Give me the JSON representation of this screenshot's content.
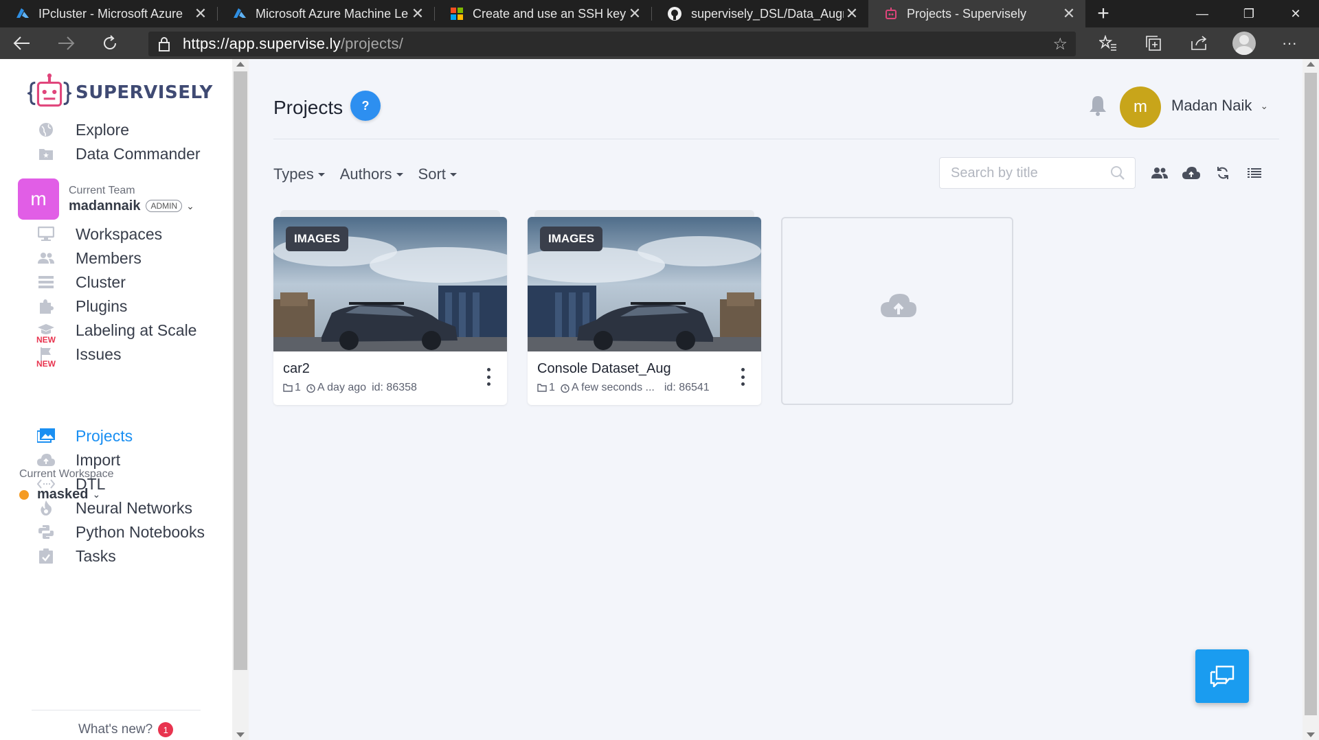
{
  "browser": {
    "tabs": [
      {
        "title": "IPcluster - Microsoft Azure",
        "icon": "azure-icon"
      },
      {
        "title": "Microsoft Azure Machine Le",
        "icon": "azure-icon"
      },
      {
        "title": "Create and use an SSH key",
        "icon": "microsoft-icon"
      },
      {
        "title": "supervisely_DSL/Data_Augn",
        "icon": "github-icon"
      },
      {
        "title": "Projects - Supervisely",
        "icon": "supervisely-icon",
        "active": true
      }
    ],
    "url_host": "https://app.supervise.ly",
    "url_path": "/projects/"
  },
  "sidebar": {
    "logo_text": "SUPERVISELY",
    "top_items": [
      {
        "label": "Explore",
        "icon": "globe-icon"
      },
      {
        "label": "Data Commander",
        "icon": "folder-star-icon"
      }
    ],
    "team": {
      "caption": "Current Team",
      "avatar_letter": "m",
      "name": "madannaik",
      "role": "ADMIN"
    },
    "team_items": [
      {
        "label": "Workspaces",
        "icon": "monitor-icon"
      },
      {
        "label": "Members",
        "icon": "members-icon"
      },
      {
        "label": "Cluster",
        "icon": "cluster-icon"
      },
      {
        "label": "Plugins",
        "icon": "puzzle-icon"
      },
      {
        "label": "Labeling at Scale",
        "icon": "graduation-cap-icon",
        "badge": "NEW"
      },
      {
        "label": "Issues",
        "icon": "flag-icon",
        "badge": "NEW"
      }
    ],
    "workspace": {
      "caption": "Current Workspace",
      "name": "masked",
      "dot_color": "#f59b23"
    },
    "workspace_items": [
      {
        "label": "Projects",
        "icon": "image-gallery-icon",
        "active": true
      },
      {
        "label": "Import",
        "icon": "cloud-upload-icon"
      },
      {
        "label": "DTL",
        "icon": "code-arrows-icon"
      },
      {
        "label": "Neural Networks",
        "icon": "flame-icon"
      },
      {
        "label": "Python Notebooks",
        "icon": "python-icon"
      },
      {
        "label": "Tasks",
        "icon": "clipboard-check-icon"
      }
    ],
    "whats_new": "What's new?",
    "whats_new_count": "1"
  },
  "header": {
    "title": "Projects",
    "help": "?",
    "user_initial": "m",
    "user_name": "Madan Naik"
  },
  "filters": {
    "types": "Types",
    "authors": "Authors",
    "sort": "Sort",
    "search_placeholder": "Search by title"
  },
  "projects": [
    {
      "type": "IMAGES",
      "title": "car2",
      "count": "1",
      "time": "A day ago",
      "id": "id: 86358"
    },
    {
      "type": "IMAGES",
      "title": "Console Dataset_Aug",
      "count": "1",
      "time": "A few seconds ...",
      "id": "id: 86541"
    }
  ],
  "colors": {
    "accent": "#1a8ff2",
    "logo": "#3f4a73",
    "team_avatar": "#e15ee6",
    "user_avatar": "#c8a51a",
    "badge_new": "#e8344f"
  }
}
